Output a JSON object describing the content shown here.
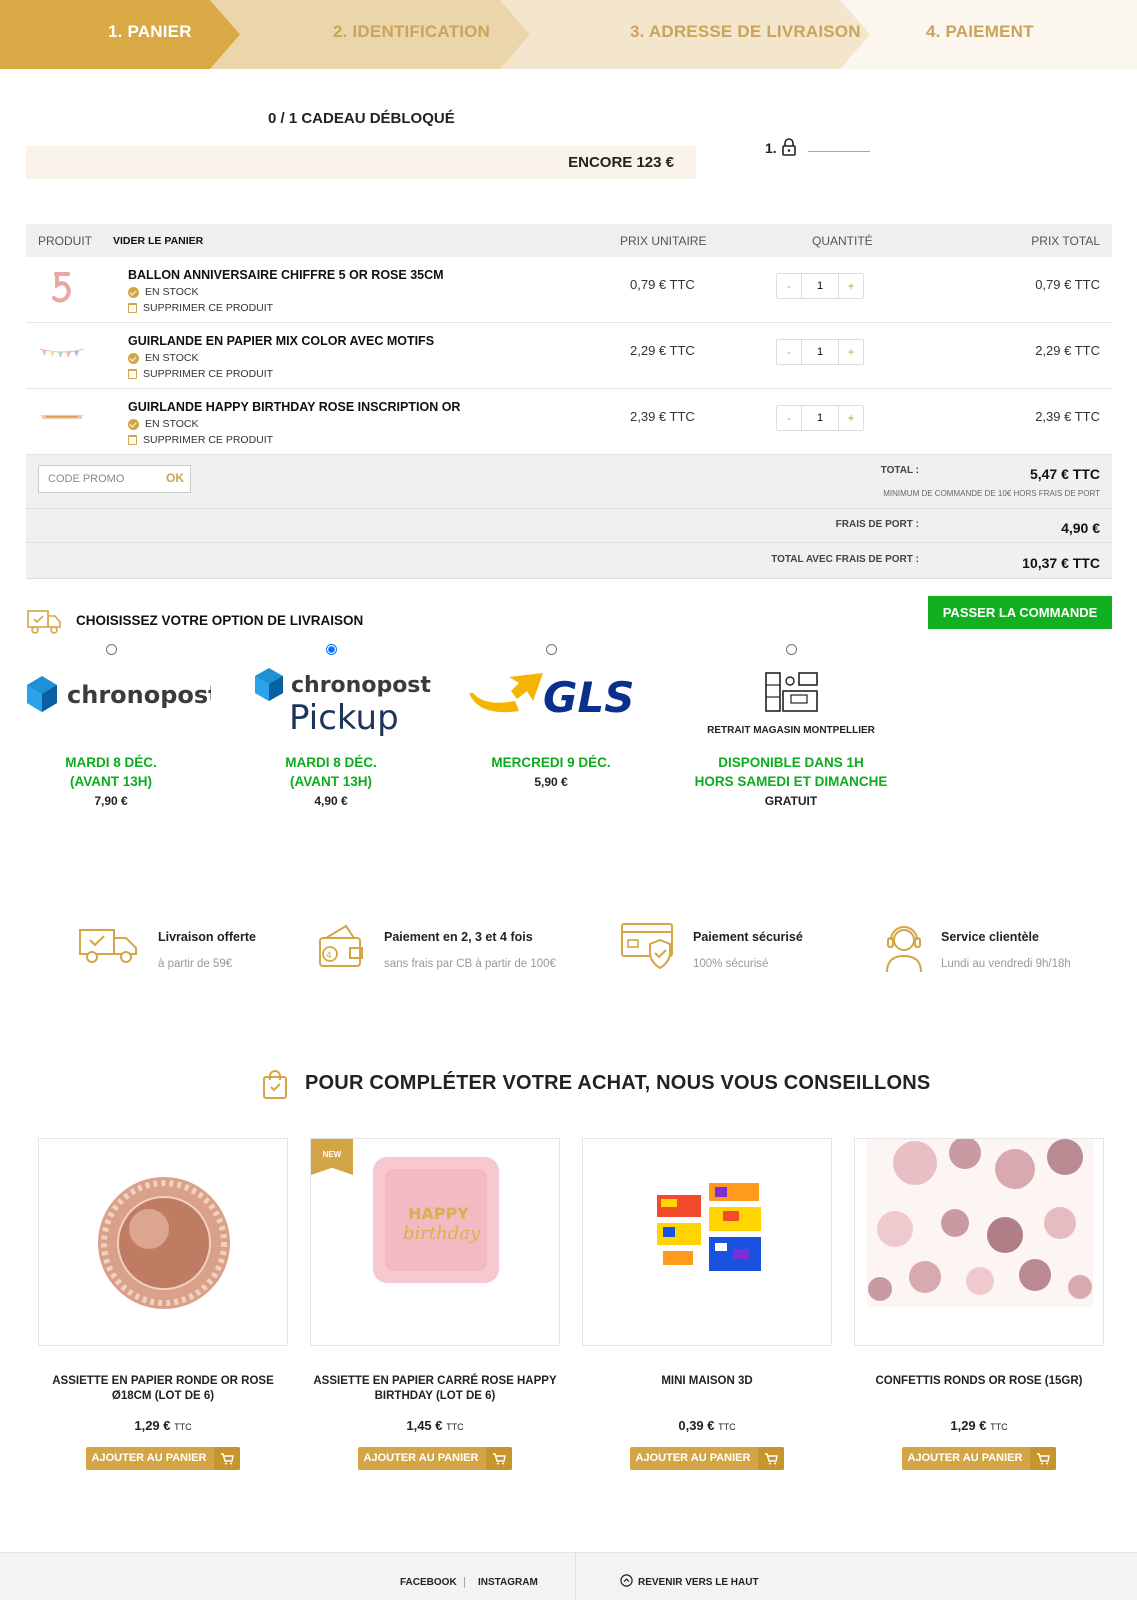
{
  "steps": [
    {
      "label": "1. PANIER",
      "active": true
    },
    {
      "label": "2. IDENTIFICATION",
      "active": false
    },
    {
      "label": "3. ADRESSE DE LIVRAISON",
      "active": false
    },
    {
      "label": "4. PAIEMENT",
      "active": false
    }
  ],
  "gift": {
    "title": "0 / 1  CADEAU DÉBLOQUÉ",
    "remaining": "ENCORE 123 €",
    "level": "1."
  },
  "cart": {
    "headers": {
      "product": "PRODUIT",
      "empty_cart": "VIDER LE PANIER",
      "unit_price": "PRIX UNITAIRE",
      "quantity": "QUANTITÉ",
      "total_price": "PRIX TOTAL"
    },
    "stock_label": "EN STOCK",
    "remove_label": "SUPPRIMER CE PRODUIT",
    "items": [
      {
        "name": "BALLON ANNIVERSAIRE CHIFFRE 5 OR ROSE 35CM",
        "unit_price": "0,79 € TTC",
        "qty": "1",
        "total": "0,79 € TTC"
      },
      {
        "name": "GUIRLANDE EN PAPIER MIX COLOR AVEC MOTIFS",
        "unit_price": "2,29 € TTC",
        "qty": "1",
        "total": "2,29 € TTC"
      },
      {
        "name": "GUIRLANDE HAPPY BIRTHDAY ROSE INSCRIPTION OR",
        "unit_price": "2,39 € TTC",
        "qty": "1",
        "total": "2,39 € TTC"
      }
    ],
    "promo": {
      "placeholder": "CODE PROMO",
      "button": "OK"
    },
    "total_label": "TOTAL :",
    "total_value": "5,47 € TTC",
    "min_note": "MINIMUM DE COMMANDE DE 10€ HORS FRAIS DE PORT",
    "shipping_label": "FRAIS DE PORT :",
    "shipping_value": "4,90 €",
    "grand_label": "TOTAL AVEC FRAIS DE PORT :",
    "grand_value": "10,37 € TTC"
  },
  "delivery": {
    "title": "CHOISISSEZ VOTRE OPTION DE LIVRAISON",
    "checkout_button": "PASSER LA COMMANDE",
    "options": [
      {
        "logo": "chronopost",
        "logo_text": "chronopost",
        "date_line1": "MARDI 8 DÉC.",
        "date_line2": "(AVANT 13H)",
        "price": "7,90 €",
        "selected": false
      },
      {
        "logo": "chronopost-pickup",
        "logo_text": "chronopost",
        "logo_text2": "Pickup",
        "date_line1": "MARDI 8 DÉC.",
        "date_line2": "(AVANT 13H)",
        "price": "4,90 €",
        "selected": true
      },
      {
        "logo": "gls",
        "logo_text": "GLS",
        "date_line1": "MERCREDI 9 DÉC.",
        "date_line2": "",
        "price": "5,90 €",
        "selected": false
      },
      {
        "logo": "store",
        "logo_text": "RETRAIT MAGASIN MONTPELLIER",
        "date_line1": "DISPONIBLE DANS 1H",
        "date_line2": "HORS SAMEDI ET DIMANCHE",
        "price": "GRATUIT",
        "selected": false
      }
    ]
  },
  "features": [
    {
      "icon": "truck-icon",
      "title": "Livraison offerte",
      "subtitle": "à partir de 59€"
    },
    {
      "icon": "wallet-icon",
      "title": "Paiement en 2, 3 et 4 fois",
      "subtitle": "sans frais par CB à partir de 100€"
    },
    {
      "icon": "secure-card-icon",
      "title": "Paiement sécurisé",
      "subtitle": "100% sécurisé"
    },
    {
      "icon": "headset-icon",
      "title": "Service clientèle",
      "subtitle": "Lundi au vendredi 9h/18h"
    }
  ],
  "recommendations": {
    "title": "POUR COMPLÉTER VOTRE ACHAT, NOUS VOUS CONSEILLONS",
    "add_label": "AJOUTER AU PANIER",
    "price_suffix": "TTC",
    "products": [
      {
        "name": "ASSIETTE EN PAPIER RONDE OR ROSE Ø18CM (LOT DE 6)",
        "price": "1,29 €",
        "badge": ""
      },
      {
        "name": "ASSIETTE EN PAPIER CARRÉ ROSE HAPPY BIRTHDAY (LOT DE 6)",
        "price": "1,45 €",
        "badge": "NEW"
      },
      {
        "name": "MINI MAISON 3D",
        "price": "0,39 €",
        "badge": ""
      },
      {
        "name": "CONFETTIS RONDS OR ROSE (15GR)",
        "price": "1,29 €",
        "badge": ""
      }
    ]
  },
  "footer": {
    "facebook": "FACEBOOK",
    "separator": "|",
    "instagram": "INSTAGRAM",
    "back_to_top": "REVENIR VERS LE HAUT"
  },
  "colors": {
    "gold": "#d4a546",
    "green": "#11b020",
    "light": "#f8f2ea"
  }
}
